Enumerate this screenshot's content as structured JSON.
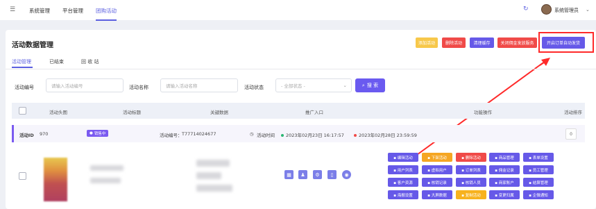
{
  "topbar": {
    "menu_icon": "menu-icon",
    "nav": [
      "系统管理",
      "平台管理",
      "团购活动"
    ],
    "refresh_icon": "refresh-icon",
    "user": "系统管理员"
  },
  "page": {
    "title": "活动数据管理"
  },
  "header_buttons": [
    {
      "label": "添加活动",
      "color": "#f7c84a"
    },
    {
      "label": "删除活动",
      "color": "#f04a48"
    },
    {
      "label": "清理缓存",
      "color": "#6659e8"
    },
    {
      "label": "关闭佣金发放服务",
      "color": "#f04a48"
    },
    {
      "label": "开启订单自动发货",
      "color": "#6659e8"
    }
  ],
  "tabs": [
    "活动管理",
    "已结束",
    "回 收 站"
  ],
  "filters": {
    "id_label": "活动编号",
    "id_placeholder": "请输入活动编号",
    "name_label": "活动名称",
    "name_placeholder": "请输入活动名称",
    "status_label": "活动状态",
    "status_value": "- 全部状态 -",
    "search_label": "搜 索"
  },
  "columns": [
    "活动头图",
    "活动标题",
    "关键数据",
    "推广入口",
    "功能操作",
    "活动排序"
  ],
  "group": {
    "id_label": "活动ID",
    "id_value": "970",
    "status": "销售中",
    "code_label": "活动编号：",
    "code_value": "T77714024677",
    "time_label": "活动时间",
    "start": "2023年02月23日 16:17:57",
    "end": "2023年02月28日 23:59:59",
    "sort_value": "0"
  },
  "row": {
    "actions": [
      [
        "编辑活动",
        "下架活动",
        "删除活动",
        "商品管理",
        "表单设置"
      ],
      [
        "用户列表",
        "虚拟用户",
        "订单列表",
        "佣金记录",
        "员工管理"
      ],
      [
        "客户资源",
        "核销记录",
        "核销人员",
        "商家账户",
        "结算管理"
      ],
      [
        "海报设置",
        "大屏数据",
        "复制活动",
        "变更归属",
        "企微通知"
      ]
    ],
    "action_colors": [
      [
        "purple",
        "orange",
        "red",
        "purple",
        "purple"
      ],
      [
        "purple",
        "purple",
        "purple",
        "purple",
        "purple"
      ],
      [
        "purple",
        "purple",
        "purple",
        "purple",
        "purple"
      ],
      [
        "purple",
        "purple",
        "yellow",
        "purple",
        "purple"
      ]
    ]
  }
}
